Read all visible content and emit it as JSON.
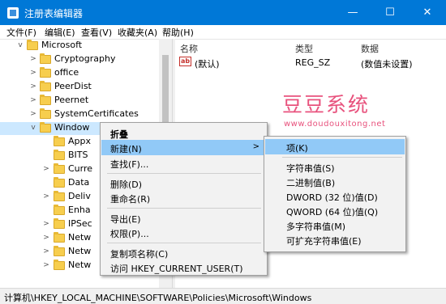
{
  "window": {
    "title": "注册表编辑器",
    "min": "—",
    "max": "☐",
    "close": "✕"
  },
  "menu": [
    "文件(F)",
    "编辑(E)",
    "查看(V)",
    "收藏夹(A)",
    "帮助(H)"
  ],
  "tree": [
    {
      "label": "Microsoft",
      "chev": "v"
    },
    {
      "label": "Cryptography",
      "chev": ">"
    },
    {
      "label": "office",
      "chev": ">"
    },
    {
      "label": "PeerDist",
      "chev": ">"
    },
    {
      "label": "Peernet",
      "chev": ">"
    },
    {
      "label": "SystemCertificates",
      "chev": ">"
    },
    {
      "label": "Window",
      "chev": "v"
    },
    {
      "label": "Appx",
      "chev": ""
    },
    {
      "label": "BITS",
      "chev": ""
    },
    {
      "label": "Curre",
      "chev": ">"
    },
    {
      "label": "Data",
      "chev": ""
    },
    {
      "label": "Deliv",
      "chev": ">"
    },
    {
      "label": "Enha",
      "chev": ""
    },
    {
      "label": "IPSec",
      "chev": ">"
    },
    {
      "label": "Netw",
      "chev": ">"
    },
    {
      "label": "Netw",
      "chev": ">"
    },
    {
      "label": "Netw",
      "chev": ">"
    }
  ],
  "columns": {
    "name": "名称",
    "type": "类型",
    "data": "数据"
  },
  "row": {
    "icon": "ab",
    "name": "(默认)",
    "type": "REG_SZ",
    "data": "(数值未设置)"
  },
  "watermark": {
    "cn": "豆豆系统",
    "url": "www.doudouxitong.net"
  },
  "context_menu": {
    "collapse": "折叠",
    "new": "新建(N)",
    "new_arrow": ">",
    "find": "查找(F)...",
    "delete": "删除(D)",
    "rename": "重命名(R)",
    "export": "导出(E)",
    "permissions": "权限(P)...",
    "copy_name": "复制项名称(C)",
    "visit": "访问 HKEY_CURRENT_USER(T)"
  },
  "submenu": [
    "项(K)",
    "字符串值(S)",
    "二进制值(B)",
    "DWORD (32 位)值(D)",
    "QWORD (64 位)值(Q)",
    "多字符串值(M)",
    "可扩充字符串值(E)"
  ],
  "status": "计算机\\HKEY_LOCAL_MACHINE\\SOFTWARE\\Policies\\Microsoft\\Windows"
}
